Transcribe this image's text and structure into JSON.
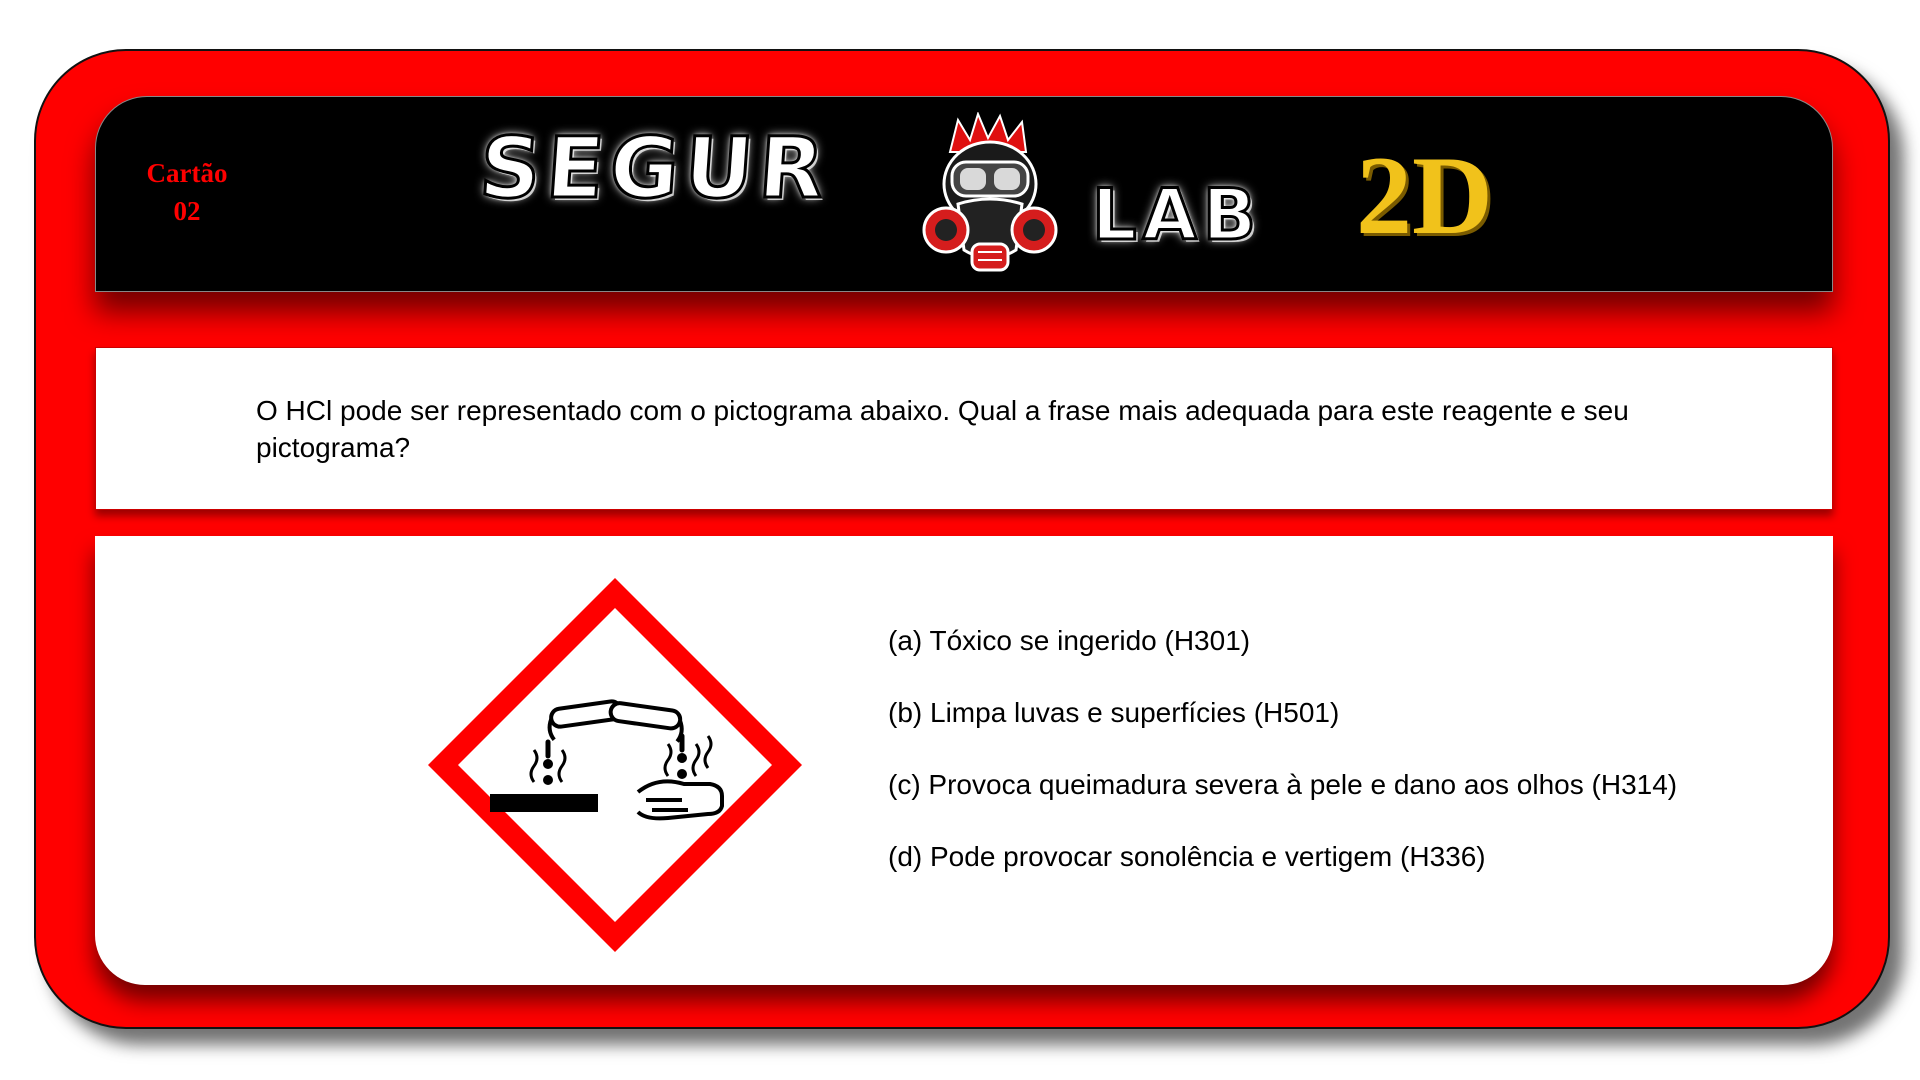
{
  "card": {
    "label_line1": "Cartão",
    "label_line2": "02"
  },
  "logo": {
    "part1": "SEGUR",
    "part2": "LAB",
    "badge": "2D",
    "mascot_icon": "gas-mask-mascot-icon"
  },
  "question": {
    "text": "O HCl pode ser representado com o pictograma abaixo. Qual a frase mais adequada para este reagente e seu pictograma?"
  },
  "pictogram": {
    "icon": "ghs-corrosive-icon",
    "border_color": "#ff0000"
  },
  "options": [
    {
      "label": "(a) Tóxico se ingerido (H301)"
    },
    {
      "label": "(b) Limpa luvas e superfícies (H501)"
    },
    {
      "label": "(c) Provoca queimadura severa à pele e dano aos olhos (H314)"
    },
    {
      "label": "(d) Pode provocar sonolência e vertigem (H336)"
    }
  ],
  "colors": {
    "card_red": "#ff0000",
    "header_black": "#000000",
    "badge_gold": "#f1c21b"
  }
}
